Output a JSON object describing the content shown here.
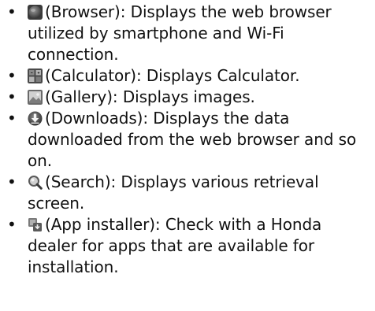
{
  "items": [
    {
      "icon": "browser-globe-icon",
      "label": "(Browser): Displays the web browser utilized by smartphone and Wi-Fi connection."
    },
    {
      "icon": "calculator-icon",
      "label": "(Calculator): Displays Calculator."
    },
    {
      "icon": "gallery-picture-icon",
      "label": "(Gallery): Displays images."
    },
    {
      "icon": "download-arrow-icon",
      "label": "(Downloads): Displays the data downloaded from the web browser and so on."
    },
    {
      "icon": "search-magnifier-icon",
      "label": "(Search): Displays various retrieval screen."
    },
    {
      "icon": "app-installer-icon",
      "label": "(App installer): Check with a Honda dealer for apps that are available for installation."
    }
  ],
  "bullet": "•"
}
